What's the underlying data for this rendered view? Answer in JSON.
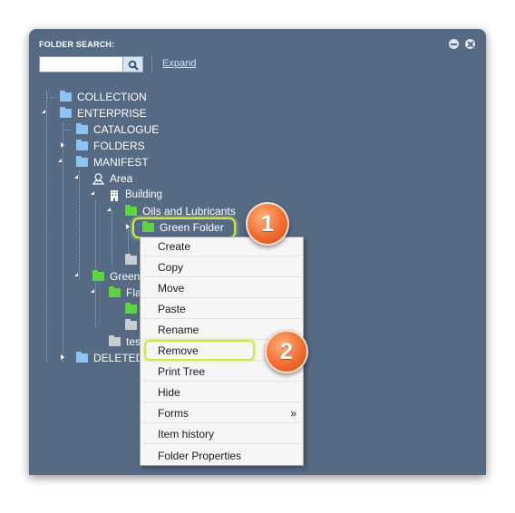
{
  "panel": {
    "title": "FOLDER SEARCH:",
    "search": {
      "value": "",
      "placeholder": ""
    },
    "expand_label": "Expand"
  },
  "tree": {
    "nodes": [
      {
        "label": "COLLECTION",
        "icon": "folder-blue-icon"
      },
      {
        "label": "ENTERPRISE",
        "icon": "folder-blue-icon"
      },
      {
        "label": "CATALOGUE",
        "icon": "folder-blue-icon"
      },
      {
        "label": "FOLDERS",
        "icon": "folder-blue-icon"
      },
      {
        "label": "MANIFEST",
        "icon": "folder-blue-icon"
      },
      {
        "label": "Area",
        "icon": "area-map-icon"
      },
      {
        "label": "Building",
        "icon": "building-icon"
      },
      {
        "label": "Oils and Lubricants",
        "icon": "folder-green-icon"
      },
      {
        "label": "Green Folder",
        "icon": "folder-green-icon"
      },
      {
        "label": "Green",
        "icon": "folder-green-icon"
      },
      {
        "label": "Fla",
        "icon": "folder-green-icon"
      },
      {
        "label": "tes",
        "icon": "folder-gray-icon"
      },
      {
        "label": "DELETED",
        "icon": "folder-blue-icon"
      }
    ]
  },
  "callouts": {
    "first": "1",
    "second": "2"
  },
  "context_menu": {
    "items": [
      {
        "label": "Create"
      },
      {
        "label": "Copy"
      },
      {
        "label": "Move"
      },
      {
        "label": "Paste"
      },
      {
        "label": "Rename"
      },
      {
        "label": "Remove"
      },
      {
        "label": "Print Tree"
      },
      {
        "label": "Hide"
      },
      {
        "label": "Forms",
        "submenu_indicator": "»"
      },
      {
        "label": "Item history"
      },
      {
        "label": "Folder Properties"
      }
    ]
  },
  "colors": {
    "panel_bg": "#566a84",
    "highlight": "#c9e94a",
    "badge": "#ef6a2c"
  }
}
